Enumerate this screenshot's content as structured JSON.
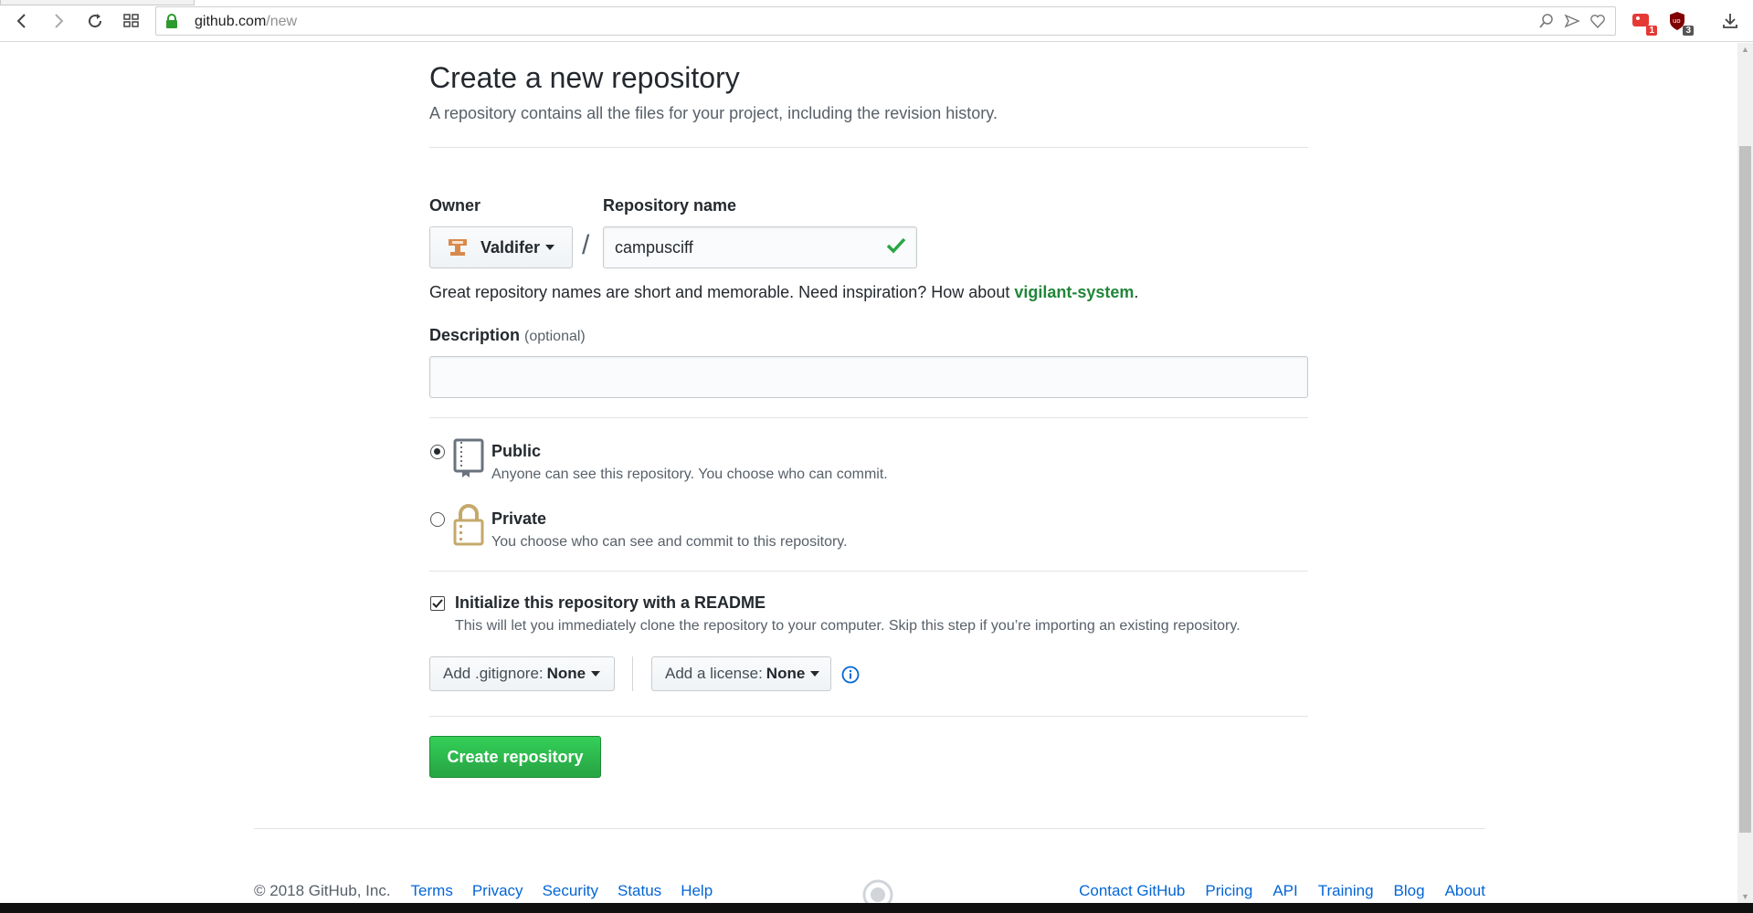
{
  "browser": {
    "url_host": "github.com",
    "url_path": "/new",
    "extensions": [
      {
        "name": "extension-1",
        "badge": "1",
        "color": "#e53935"
      },
      {
        "name": "ublock",
        "badge": "3",
        "color": "#800000"
      }
    ]
  },
  "page": {
    "title": "Create a new repository",
    "subtitle": "A repository contains all the files for your project, including the revision history."
  },
  "owner": {
    "label": "Owner",
    "value": "Valdifer"
  },
  "repo": {
    "label": "Repository name",
    "value": "campusciff",
    "separator": "/",
    "hint_prefix": "Great repository names are short and memorable. Need inspiration? How about ",
    "hint_suggestion": "vigilant-system",
    "hint_suffix": "."
  },
  "description": {
    "label": "Description",
    "optional": "(optional)",
    "value": ""
  },
  "visibility": {
    "public": {
      "title": "Public",
      "desc": "Anyone can see this repository. You choose who can commit.",
      "selected": true
    },
    "private": {
      "title": "Private",
      "desc": "You choose who can see and commit to this repository.",
      "selected": false
    }
  },
  "readme": {
    "title": "Initialize this repository with a README",
    "desc": "This will let you immediately clone the repository to your computer. Skip this step if you’re importing an existing repository.",
    "checked": true
  },
  "gitignore": {
    "label": "Add .gitignore:",
    "value": "None"
  },
  "license": {
    "label": "Add a license:",
    "value": "None"
  },
  "submit": {
    "label": "Create repository"
  },
  "footer": {
    "copyright": "© 2018 GitHub, Inc.",
    "left_links": [
      "Terms",
      "Privacy",
      "Security",
      "Status",
      "Help"
    ],
    "right_links": [
      "Contact GitHub",
      "Pricing",
      "API",
      "Training",
      "Blog",
      "About"
    ]
  },
  "colors": {
    "accent_green": "#28a745",
    "link_blue": "#0366d6",
    "suggestion_green": "#22863a"
  }
}
